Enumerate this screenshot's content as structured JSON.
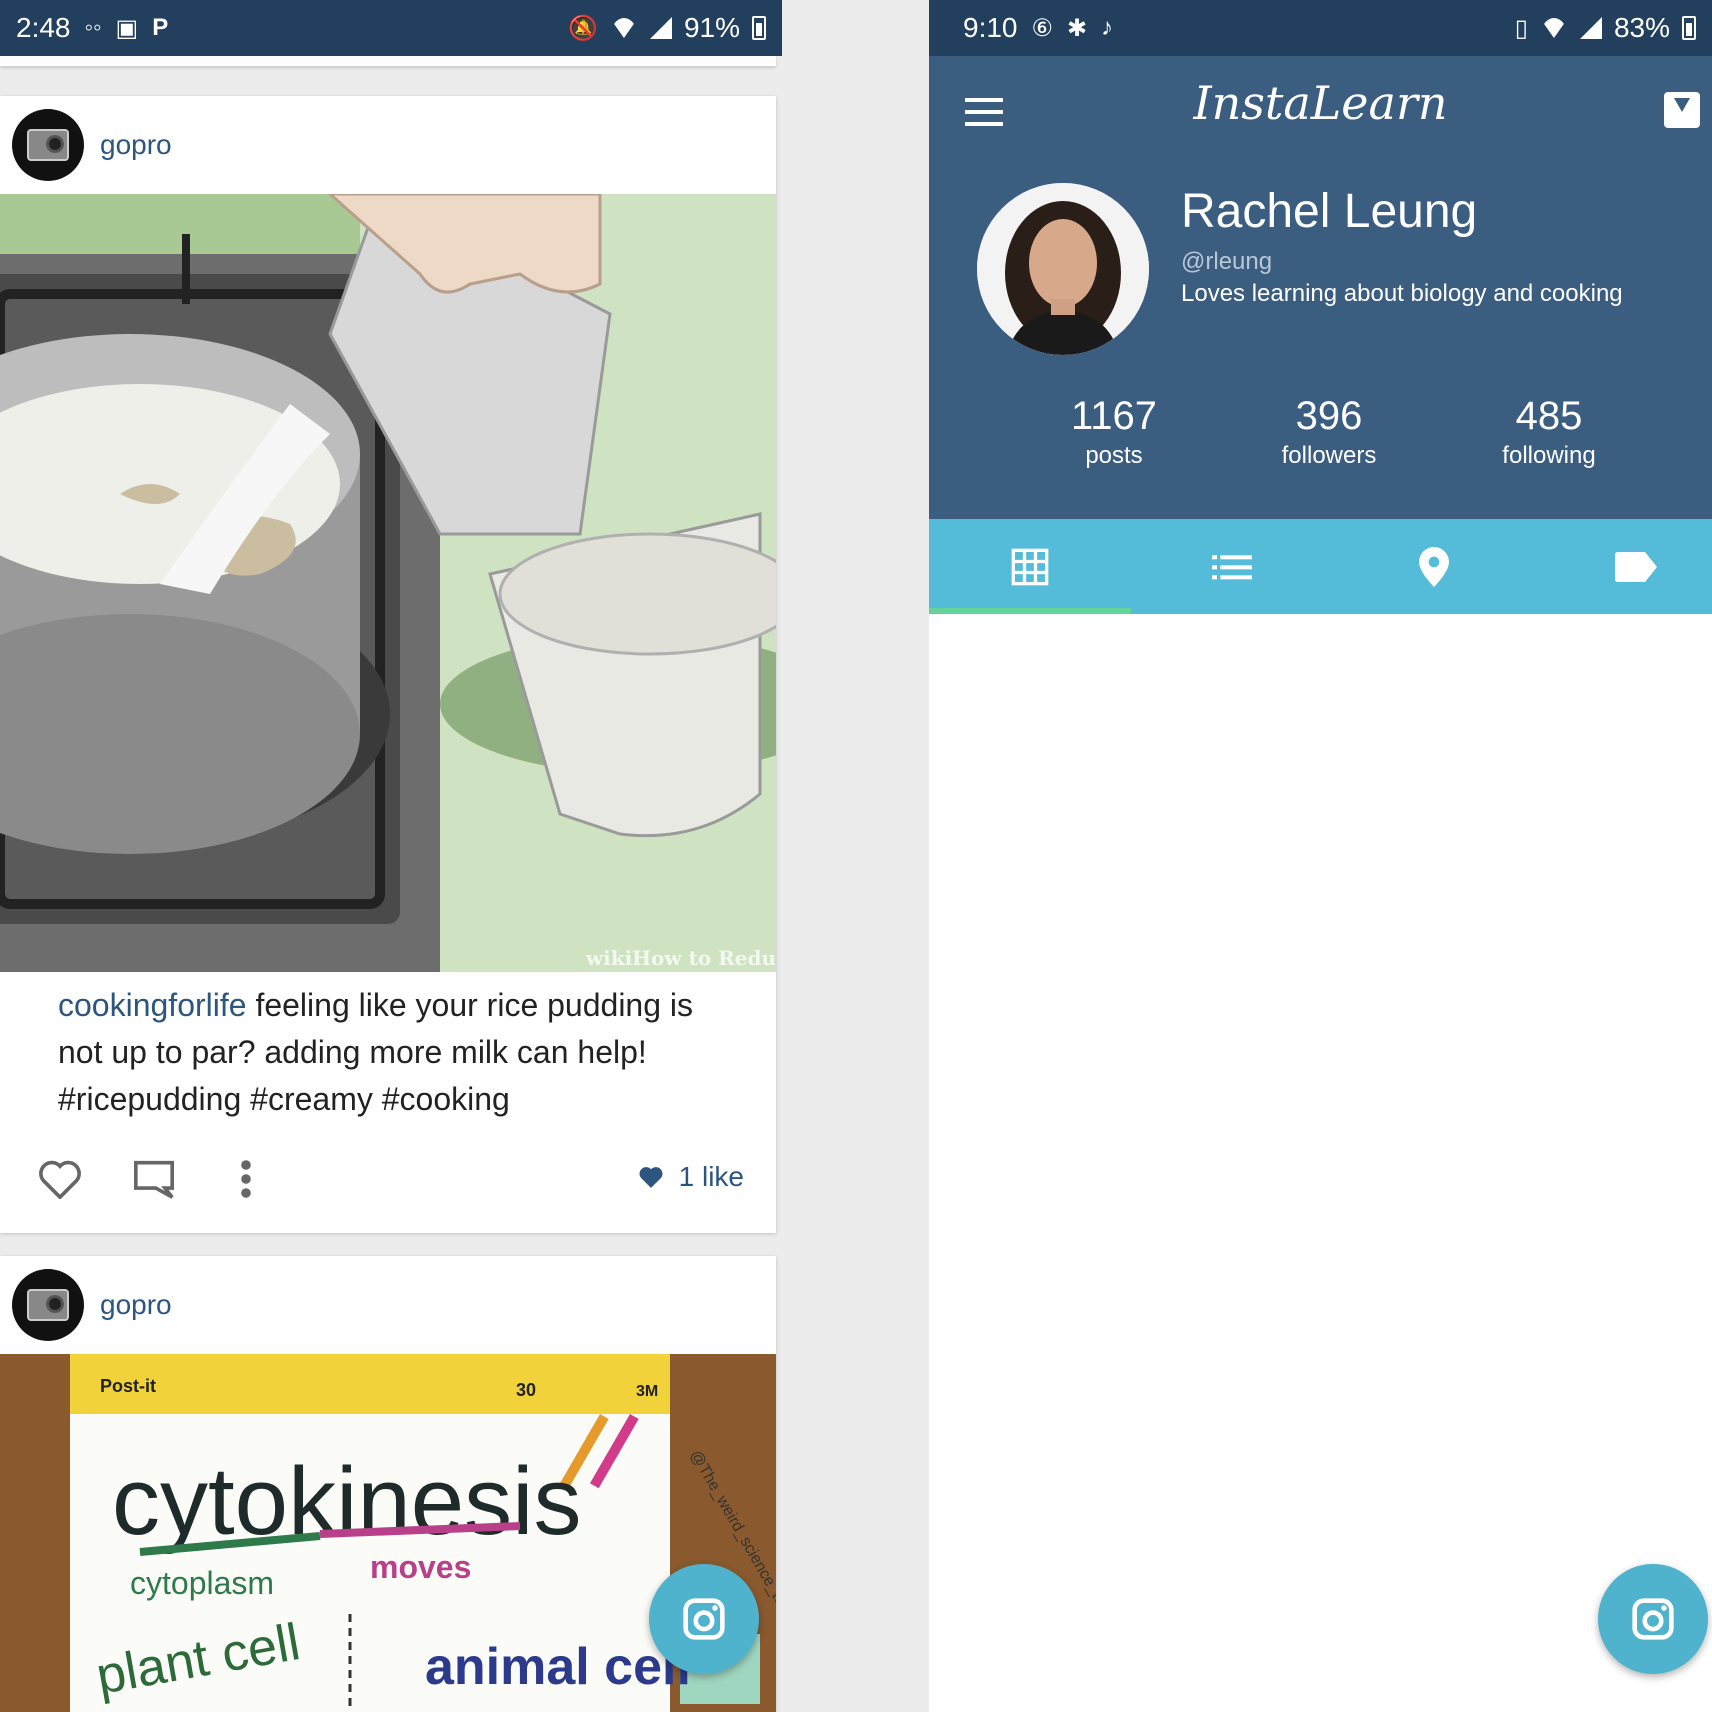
{
  "left_screen": {
    "status": {
      "time": "2:48",
      "battery": "91%"
    },
    "posts": [
      {
        "username": "gopro",
        "image_watermark": "wikiHow to Redu",
        "caption_user": "cookingforlife",
        "caption_text": " feeling like your rice pudding is not up to par? adding more milk can help! #ricepudding #creamy #cooking",
        "likes": "1 like"
      },
      {
        "username": "gopro",
        "image_text": {
          "brand": "Post-it",
          "title": "cytokinesis",
          "sub1": "cytoplasm",
          "sub2": "moves",
          "plant": "plant cell",
          "animal": "animal cell",
          "tag": "@The_weird_science_teacher",
          "count": "30",
          "maker": "3M"
        }
      }
    ]
  },
  "right_screen": {
    "status": {
      "time": "9:10",
      "battery": "83%"
    },
    "app": {
      "logo": "InstaLearn"
    },
    "profile": {
      "name": "Rachel Leung",
      "handle": "@rleung",
      "bio": "Loves learning about biology and cooking"
    },
    "stats": [
      {
        "value": "1167",
        "label": "posts"
      },
      {
        "value": "396",
        "label": "followers"
      },
      {
        "value": "485",
        "label": "following"
      }
    ],
    "tabs": [
      {
        "icon": "grid-icon",
        "active": true
      },
      {
        "icon": "list-icon",
        "active": false
      },
      {
        "icon": "location-pin-icon",
        "active": false
      },
      {
        "icon": "tag-icon",
        "active": false
      }
    ]
  },
  "colors": {
    "status_bar": "#22405e",
    "app_bar": "#3a5d80",
    "tab_bar": "#54bcd8",
    "tab_indicator": "#63d39a",
    "fab": "#4fb3ce",
    "link": "#2c5580"
  }
}
